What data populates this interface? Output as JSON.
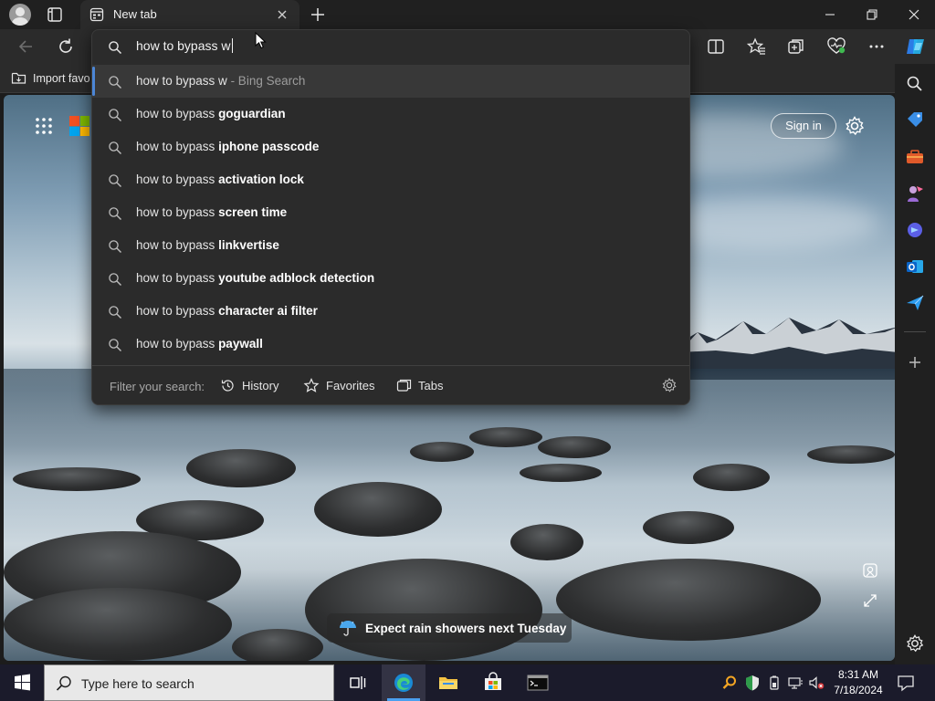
{
  "tab": {
    "title": "New tab"
  },
  "address": {
    "value": "how to bypass w"
  },
  "suggestions": [
    {
      "prefix": "how to bypass w",
      "completion": "",
      "engine": " - Bing Search"
    },
    {
      "prefix": "how to bypass ",
      "completion": "goguardian",
      "engine": ""
    },
    {
      "prefix": "how to bypass ",
      "completion": "iphone passcode",
      "engine": ""
    },
    {
      "prefix": "how to bypass ",
      "completion": "activation lock",
      "engine": ""
    },
    {
      "prefix": "how to bypass ",
      "completion": "screen time",
      "engine": ""
    },
    {
      "prefix": "how to bypass ",
      "completion": "linkvertise",
      "engine": ""
    },
    {
      "prefix": "how to bypass ",
      "completion": "youtube adblock detection",
      "engine": ""
    },
    {
      "prefix": "how to bypass ",
      "completion": "character ai filter",
      "engine": ""
    },
    {
      "prefix": "how to bypass ",
      "completion": "paywall",
      "engine": ""
    }
  ],
  "filter": {
    "label": "Filter your search:",
    "history": "History",
    "favorites": "Favorites",
    "tabs": "Tabs"
  },
  "favorites_bar": {
    "import_label": "Import favo"
  },
  "newtab_page": {
    "sign_in": "Sign in",
    "weather": "Expect rain showers next Tuesday"
  },
  "taskbar": {
    "search_placeholder": "Type here to search",
    "time": "8:31 AM",
    "date": "7/18/2024"
  },
  "colors": {
    "accent": "#4c86d6",
    "dropdown_bg": "#2b2b2b",
    "selected_row": "#383838"
  },
  "icons": [
    "profile-avatar",
    "tab-actions-icon",
    "new-tab-icon",
    "back-icon",
    "refresh-icon",
    "split-screen-icon",
    "favorites-icon",
    "collections-icon",
    "browser-essentials-icon",
    "more-icon",
    "copilot-icon",
    "search-icon",
    "shopping-tag-icon",
    "tools-icon",
    "games-icon",
    "copilot-sidebar-icon",
    "outlook-icon",
    "send-icon",
    "add-icon",
    "settings-icon",
    "history-icon",
    "star-icon",
    "tabs-icon",
    "gear-icon",
    "start-icon",
    "task-view-icon",
    "edge-icon",
    "file-explorer-icon",
    "store-icon",
    "terminal-icon"
  ]
}
